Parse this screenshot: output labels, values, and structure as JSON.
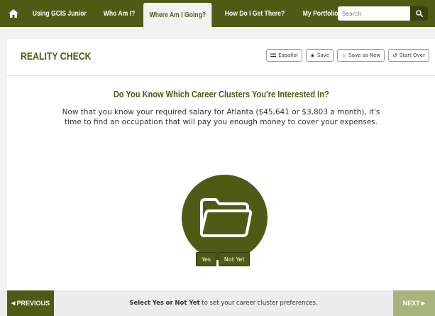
{
  "nav": {
    "items": [
      {
        "label": "Using GCIS Junior"
      },
      {
        "label": "Who Am I?"
      },
      {
        "label": "Where Am I Going?"
      },
      {
        "label": "How Do I Get There?"
      },
      {
        "label": "My Portfolio"
      }
    ],
    "search_placeholder": "Search"
  },
  "panel": {
    "title": "REALITY CHECK",
    "toolbar": {
      "espanol": "Español",
      "save": "Save",
      "save_as_new": "Save as New",
      "start_over": "Start Over"
    },
    "heading": "Do You Know Which Career Clusters You're Interested In?",
    "description": "Now that you know your required salary for Atlanta ($45,641 or $3,803 a month), it's time to find an occupation that will pay you enough money to cover your expenses.",
    "yes_label": "Yes",
    "not_yet_label": "Not Yet"
  },
  "footer": {
    "previous_label": "PREVIOUS",
    "next_label": "NEXT",
    "msg_before": "Select",
    "msg_yes": "Yes",
    "msg_or": "or",
    "msg_not_yet": "Not Yet",
    "msg_after": "to set your career cluster preferences."
  },
  "colors": {
    "brand": "#4f5a14",
    "next_disabled": "#a9b47c"
  }
}
